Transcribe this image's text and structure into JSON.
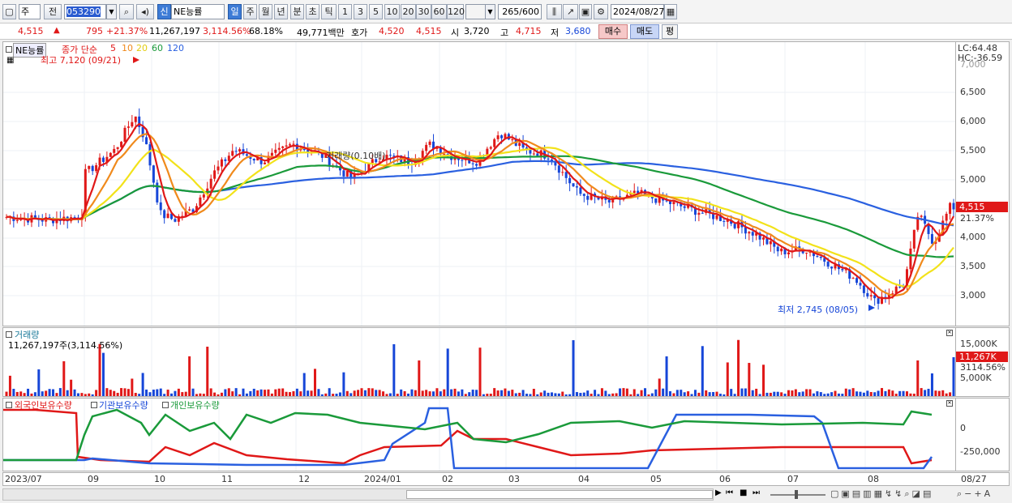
{
  "toolbar": {
    "mode": "주",
    "prev_label": "전",
    "code": "053290",
    "name_badge": "신",
    "name": "NE능률",
    "periods": [
      "일",
      "주",
      "월",
      "년",
      "분",
      "초",
      "틱"
    ],
    "active_period": "일",
    "intervals": [
      "1",
      "3",
      "5",
      "10",
      "20",
      "30",
      "60",
      "120"
    ],
    "count": "265",
    "count_total": "/600",
    "date": "2024/08/27"
  },
  "quote": {
    "price": "4,515",
    "change": "795",
    "change_pct": "+21.37%",
    "volume": "11,267,197",
    "vol_pct": "3,114.56%",
    "vol_ratio": "68.18%",
    "amount": "49,771백만",
    "hoga_label": "호가",
    "hoga1": "4,520",
    "hoga2": "4,515",
    "open_label": "시",
    "open": "3,720",
    "high_label": "고",
    "high": "4,715",
    "low_label": "저",
    "low": "3,680",
    "buy": "매수",
    "sell": "매도",
    "eval": "평"
  },
  "price_pane": {
    "title": "NE능률",
    "ma_label": "종가 단순",
    "ma_periods": [
      "5",
      "10",
      "20",
      "60",
      "120"
    ],
    "ma_colors": [
      "#e01818",
      "#f08a1c",
      "#f2e21a",
      "#1a9a3a",
      "#2a60e0"
    ],
    "high_note": "최고 7,120 (09/21)",
    "low_note": "최저 2,745 (08/05)",
    "mid_note": "거래량(0.10배)",
    "lc": "LC:64.48",
    "hc": "HC:-36.59",
    "last_price": "4,515",
    "last_pct": "21.37%",
    "ticks": [
      "6,500",
      "6,000",
      "5,500",
      "5,000",
      "4,500",
      "4,000",
      "3,500",
      "3,000"
    ],
    "top_tick": "7,000"
  },
  "volume_pane": {
    "title": "거래량",
    "value": "11,267,197주(3,114.56%)",
    "ticks": [
      "15,000K",
      "5,000K"
    ],
    "last": "11,267K",
    "last_pct": "3114.56%"
  },
  "holder_pane": {
    "series": [
      "외국인보유수량",
      "기관보유수량",
      "개인보유수량"
    ],
    "colors": [
      "#e01818",
      "#2a60e0",
      "#1a9a3a"
    ],
    "ticks": [
      "0",
      "-250,000"
    ]
  },
  "xaxis": [
    "2023/07",
    "09",
    "10",
    "11",
    "12",
    "2024/01",
    "02",
    "03",
    "04",
    "05",
    "06",
    "07",
    "08",
    "08/27"
  ]
}
